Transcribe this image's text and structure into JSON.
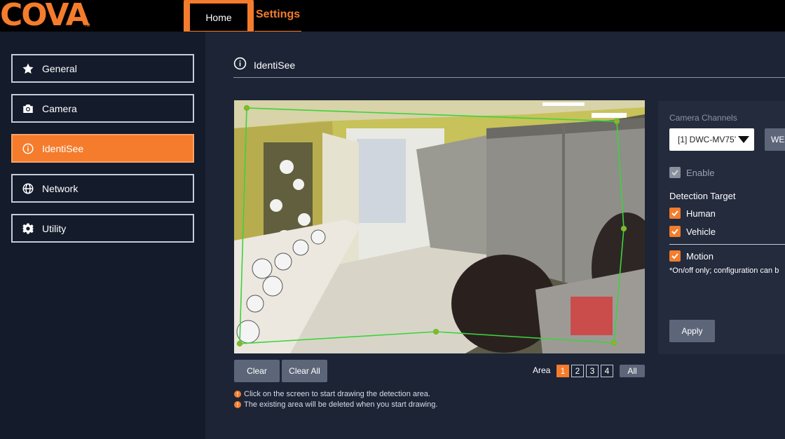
{
  "brand": {
    "logo_text": "COVA",
    "tm": "TM"
  },
  "topnav": {
    "home_label": "Home",
    "settings_label": "Settings"
  },
  "sidebar": {
    "items": [
      {
        "label": "General",
        "icon": "star-icon"
      },
      {
        "label": "Camera",
        "icon": "camera-icon"
      },
      {
        "label": "IdentiSee",
        "icon": "info-icon",
        "active": true
      },
      {
        "label": "Network",
        "icon": "globe-icon"
      },
      {
        "label": "Utility",
        "icon": "gear-icon"
      }
    ]
  },
  "section": {
    "title": "IdentiSee"
  },
  "controls": {
    "clear_label": "Clear",
    "clear_all_label": "Clear All",
    "area_label": "Area",
    "areas": [
      "1",
      "2",
      "3",
      "4"
    ],
    "active_area": "1",
    "all_label": "All"
  },
  "hints": [
    "Click on the screen to start drawing the detection area.",
    "The existing area will be deleted when you start drawing."
  ],
  "panel": {
    "channels_label": "Camera Channels",
    "channel_selected": "[1] DWC-MV75’",
    "web_label": "WE",
    "enable_label": "Enable",
    "detection_target_label": "Detection Target",
    "human_label": "Human",
    "vehicle_label": "Vehicle",
    "motion_label": "Motion",
    "note": "*On/off only; configuration can b",
    "apply_label": "Apply"
  },
  "colors": {
    "accent": "#f47c2c",
    "zone": "#3cd33c"
  }
}
